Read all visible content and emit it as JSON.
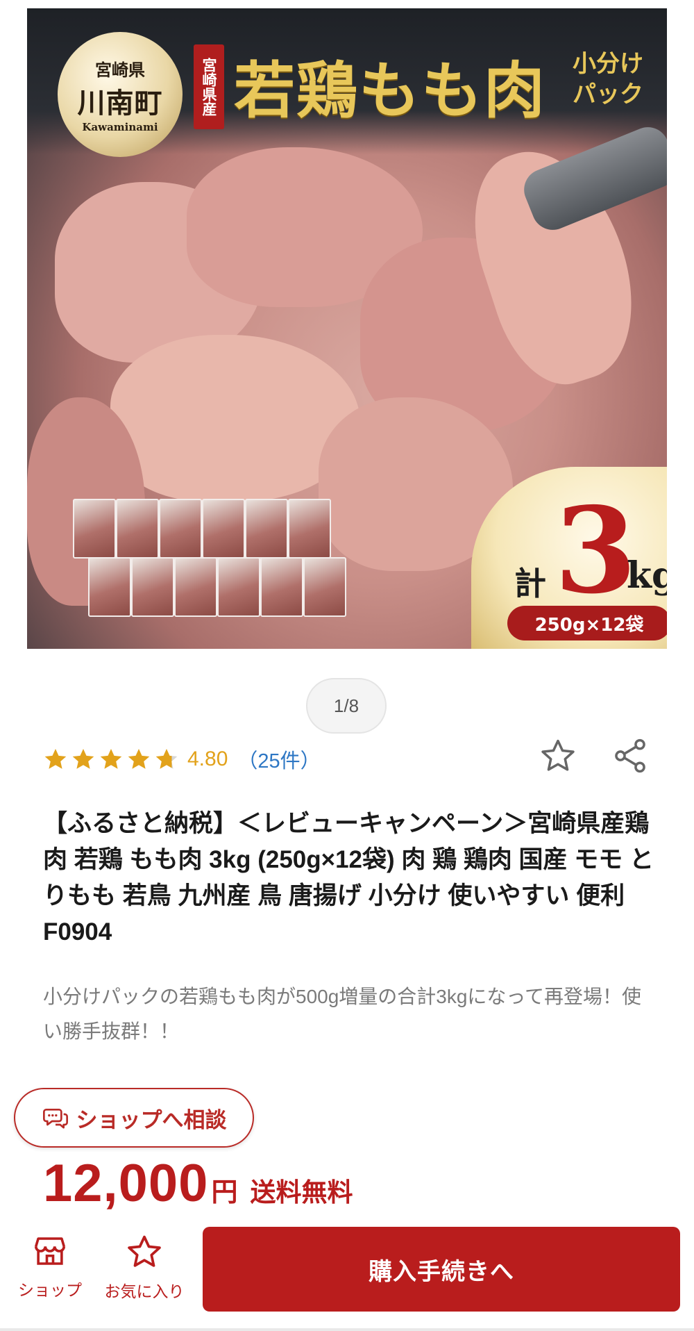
{
  "hero": {
    "seal_line1": "宮崎県",
    "seal_line2": "川南町",
    "seal_line3": "Kawaminami",
    "origin_tag": "宮崎県産",
    "headline": "若鶏もも肉",
    "headline_sub": "小分けパック",
    "total_prefix": "計",
    "total_number": "3",
    "total_unit": "kg",
    "pack_note": "250g×12袋"
  },
  "pager": {
    "text": "1/8"
  },
  "rating": {
    "value": 4.8,
    "score_text": "4.80",
    "count_text": "（25件）",
    "star_color": "#e2a21b"
  },
  "title": "【ふるさと納税】＜レビューキャンペーン＞宮崎県産鶏肉 若鶏 もも肉 3kg (250g×12袋) 肉 鶏 鶏肉 国産 モモ とりもも 若鳥 九州産 鳥 唐揚げ 小分け 使いやすい 便利 F0904",
  "catch_copy": "小分けパックの若鶏もも肉が500g増量の合計3kgになって再登場！使い勝手抜群！！",
  "consult": {
    "label": "ショップへ相談"
  },
  "price": {
    "amount": "12,000",
    "unit": "円",
    "shipping": "送料無料"
  },
  "bottom_nav": {
    "shop_label": "ショップ",
    "favorite_label": "お気に入り",
    "buy_label": "購入手続きへ"
  },
  "colors": {
    "accent": "#b91d1d",
    "rating": "#e2a21b",
    "link": "#2e77c4"
  },
  "icons": [
    "star-outline-icon",
    "share-icon",
    "chat-icon",
    "shop-icon",
    "favorite-star-icon"
  ]
}
